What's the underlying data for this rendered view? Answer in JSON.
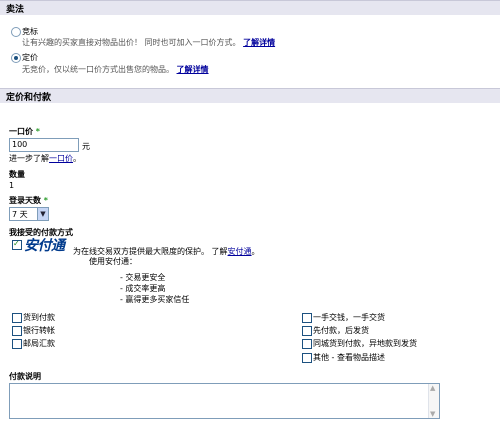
{
  "selling_method": {
    "title": "卖法",
    "options": [
      {
        "label": "竞标",
        "desc": "让有兴趣的买家直接对物品出价！ 同时也可加入一口价方式。",
        "link": "了解详情",
        "checked": false
      },
      {
        "label": "定价",
        "desc": "无竞价，仅以统一口价方式出售您的物品。",
        "link": "了解详情",
        "checked": true
      }
    ]
  },
  "pricing": {
    "title": "定价和付款",
    "buy_now": {
      "label": "一口价",
      "required": "*",
      "value": "100",
      "unit": "元",
      "hint_prefix": "进一步了解",
      "hint_link": "一口价",
      "hint_suffix": "。"
    },
    "quantity": {
      "label": "数量",
      "value": "1"
    },
    "duration": {
      "label": "登录天数",
      "required": "*",
      "value": "7 天"
    },
    "payment": {
      "label": "我接受的付款方式",
      "brand": "安付通",
      "brand_checked": true,
      "brand_desc_prefix": "为在线交易双方提供最大限度的保护。 了解",
      "brand_link": "安付通",
      "brand_desc_suffix": "。",
      "use_label": "使用安付通：",
      "benefits": [
        "- 交易更安全",
        "- 成交率更高",
        "- 赢得更多买家信任"
      ],
      "methods_left": [
        "货到付款",
        "银行转帐",
        "邮局汇款"
      ],
      "methods_right": [
        "一手交钱，一手交货",
        "先付款，后发货",
        "同城货到付款，异地款到发货",
        "其他 - 查看物品描述"
      ]
    },
    "notes": {
      "label": "付款说明",
      "value": ""
    }
  }
}
